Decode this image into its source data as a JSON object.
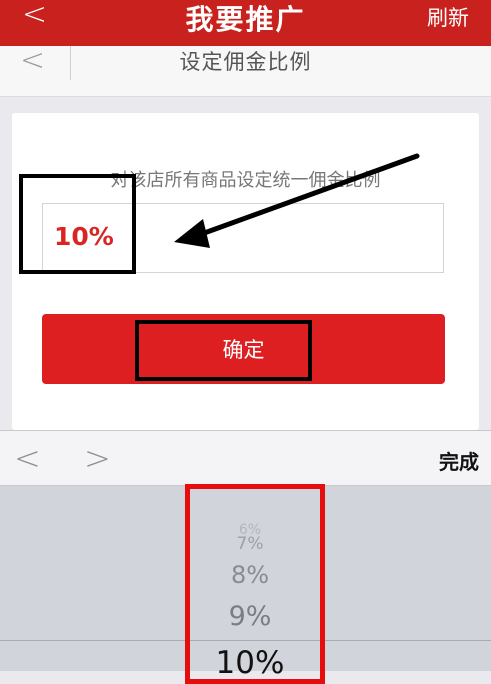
{
  "nav": {
    "back_symbol": "<",
    "title": "我要推广",
    "refresh": "刷新"
  },
  "subheader": {
    "back_symbol": "<",
    "title": "设定佣金比例"
  },
  "form": {
    "hint": "对该店所有商品设定统一佣金比例",
    "commission_value": "10%",
    "confirm_label": "确定"
  },
  "accessory": {
    "prev_symbol": "<",
    "next_symbol": ">",
    "done": "完成"
  },
  "picker": {
    "items": [
      "6%",
      "7%",
      "8%",
      "9%",
      "10%"
    ],
    "selected": "10%"
  },
  "colors": {
    "brand_red": "#c9211e",
    "button_red": "#dd1f22",
    "value_red": "#d92622",
    "annotation_red": "#e50d0d"
  }
}
